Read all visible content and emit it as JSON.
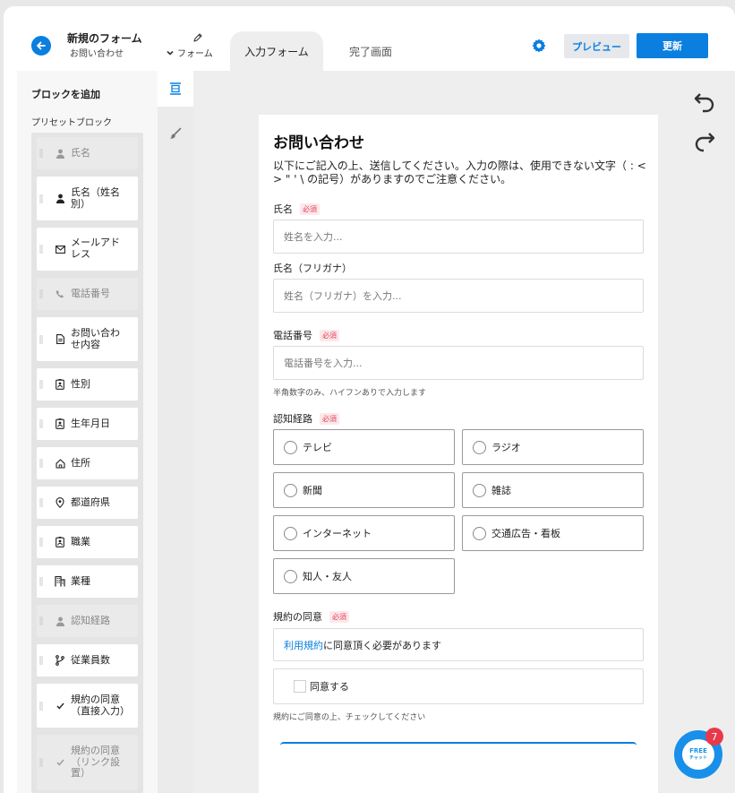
{
  "header": {
    "title": "新規のフォーム",
    "subtitle": "お問い合わせ",
    "form_menu_label": "フォーム",
    "tabs": [
      {
        "label": "入力フォーム",
        "active": true
      },
      {
        "label": "完了画面",
        "active": false
      }
    ],
    "preview_label": "プレビュー",
    "update_label": "更新",
    "accent_color": "#0a7fe0"
  },
  "sidebar": {
    "title": "ブロックを追加",
    "preset_title": "プリセットブロック",
    "blocks": [
      {
        "label": "氏名",
        "icon": "person-icon",
        "disabled": true
      },
      {
        "label": "氏名（姓名別）",
        "icon": "person-icon",
        "disabled": false
      },
      {
        "label": "メールアドレス",
        "icon": "mail-icon",
        "disabled": false
      },
      {
        "label": "電話番号",
        "icon": "phone-icon",
        "disabled": true
      },
      {
        "label": "お問い合わせ内容",
        "icon": "document-icon",
        "disabled": false
      },
      {
        "label": "性別",
        "icon": "badge-icon",
        "disabled": false
      },
      {
        "label": "生年月日",
        "icon": "badge-icon",
        "disabled": false
      },
      {
        "label": "住所",
        "icon": "home-icon",
        "disabled": false
      },
      {
        "label": "都道府県",
        "icon": "location-pin-icon",
        "disabled": false
      },
      {
        "label": "職業",
        "icon": "badge-icon",
        "disabled": false
      },
      {
        "label": "業種",
        "icon": "building-icon",
        "disabled": false
      },
      {
        "label": "認知経路",
        "icon": "person-icon",
        "disabled": true
      },
      {
        "label": "従業員数",
        "icon": "branch-icon",
        "disabled": false
      },
      {
        "label": "規約の同意（直接入力）",
        "icon": "check-icon",
        "disabled": false
      },
      {
        "label": "規約の同意（リンク設置）",
        "icon": "check-icon",
        "disabled": true
      }
    ]
  },
  "form": {
    "title": "お問い合わせ",
    "description": "以下にご記入の上、送信してください。入力の際は、使用できない文字（ : < > \" ' \\ の記号）がありますのでご注意ください。",
    "required_label": "必須",
    "fields": {
      "name": {
        "label": "氏名",
        "placeholder": "姓名を入力..."
      },
      "kana": {
        "label": "氏名（フリガナ）",
        "placeholder": "姓名（フリガナ）を入力..."
      },
      "phone": {
        "label": "電話番号",
        "placeholder": "電話番号を入力...",
        "hint": "半角数字のみ、ハイフンありで入力します"
      },
      "source": {
        "label": "認知経路",
        "options": [
          "テレビ",
          "ラジオ",
          "新聞",
          "雑誌",
          "インターネット",
          "交通広告・看板",
          "知人・友人"
        ]
      },
      "terms": {
        "label": "規約の同意",
        "link_text": "利用規約",
        "text": "に同意頂く必要があります",
        "checkbox_label": "同意する",
        "hint": "規約にご同意の上、チェックしてください"
      }
    }
  },
  "chat": {
    "label": "FREE",
    "sublabel": "チャット",
    "badge": "7"
  }
}
